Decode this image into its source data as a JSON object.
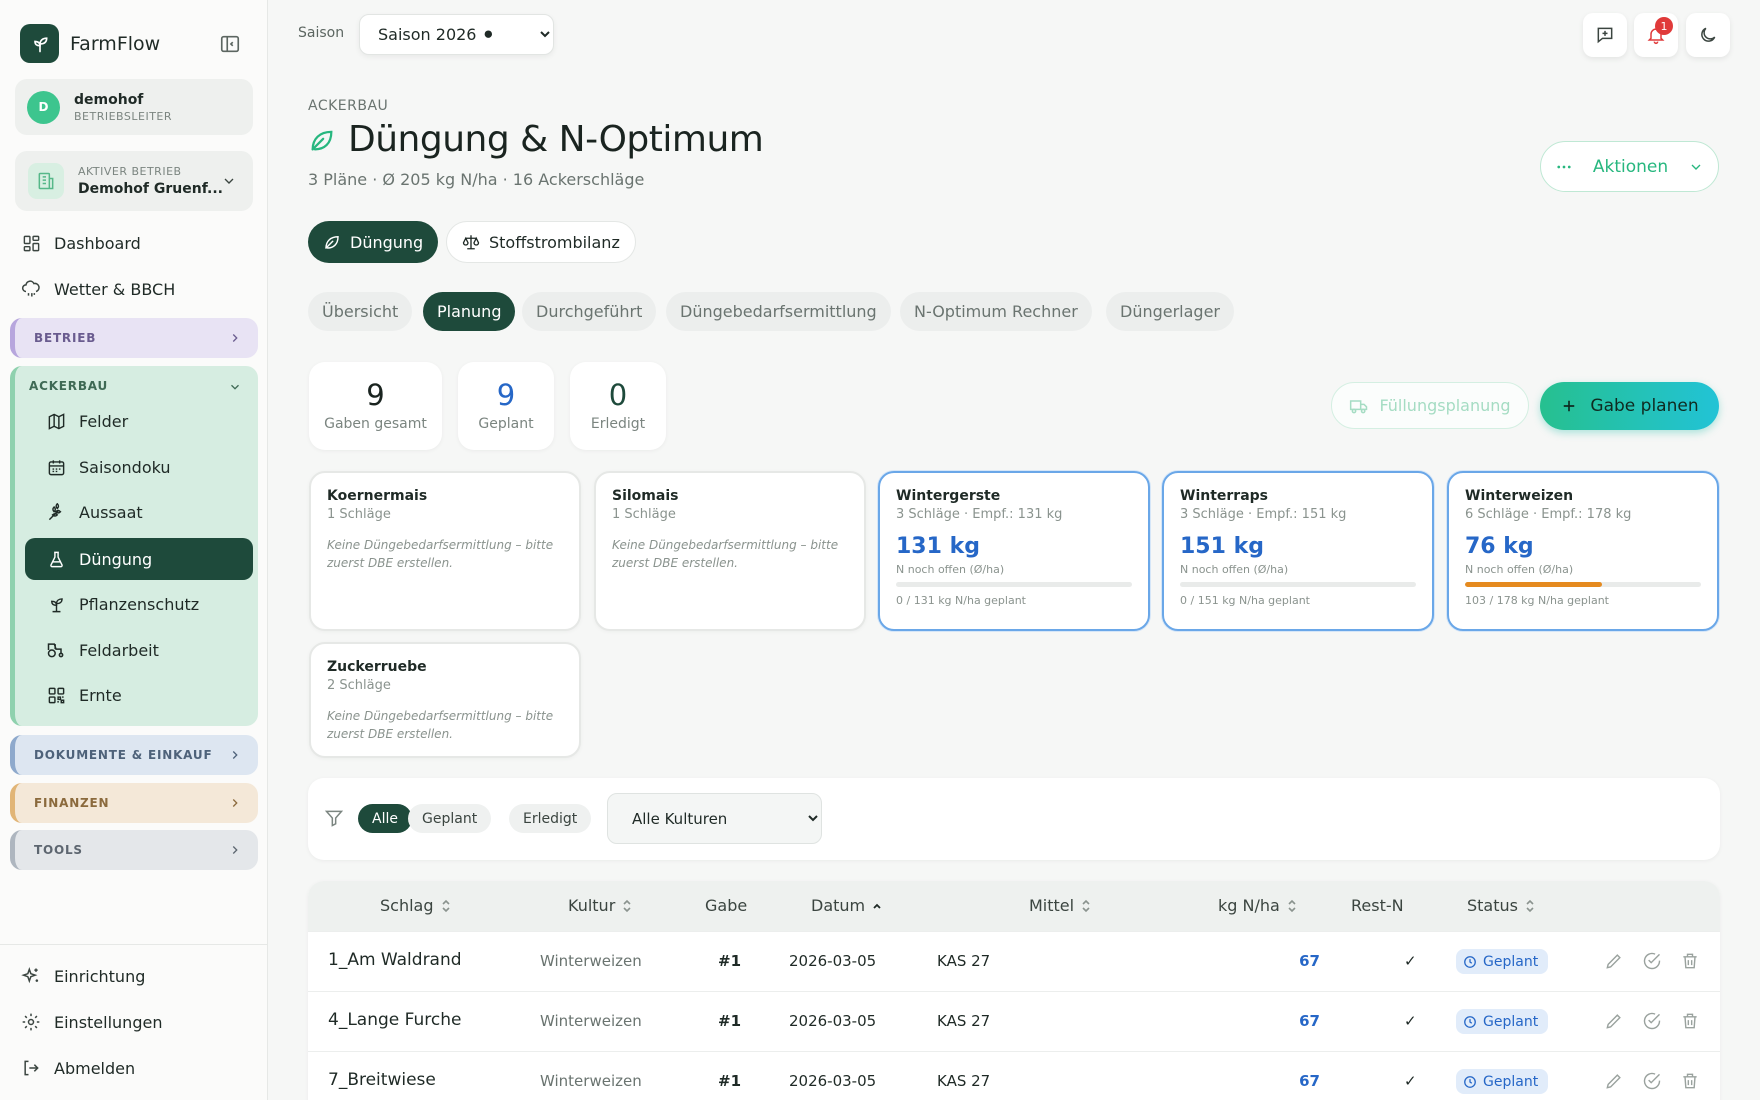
{
  "app": {
    "name": "FarmFlow"
  },
  "user": {
    "initial": "D",
    "name": "demohof",
    "role": "BETRIEBSLEITER"
  },
  "farm": {
    "label": "AKTIVER BETRIEB",
    "name": "Demohof Gruenf..."
  },
  "nav": {
    "dashboard": "Dashboard",
    "wetter": "Wetter & BBCH",
    "betrieb": "BETRIEB",
    "ackerbau": "ACKERBAU",
    "ackerbau_items": [
      "Felder",
      "Saisondoku",
      "Aussaat",
      "Düngung",
      "Pflanzenschutz",
      "Feldarbeit",
      "Ernte"
    ],
    "dokumente": "DOKUMENTE & EINKAUF",
    "finanzen": "FINANZEN",
    "tools": "TOOLS",
    "einrichtung": "Einrichtung",
    "einstellungen": "Einstellungen",
    "abmelden": "Abmelden"
  },
  "topbar": {
    "season_label": "Saison",
    "season_value": "Saison 2026 ⚫",
    "notification_count": "1"
  },
  "header": {
    "eyebrow": "ACKERBAU",
    "title": "Düngung & N-Optimum",
    "subtitle": "3 Pläne · Ø 205 kg N/ha · 16 Ackerschläge",
    "actions": "Aktionen"
  },
  "main_tabs": [
    "Düngung",
    "Stoffstrombilanz"
  ],
  "sub_tabs": [
    "Übersicht",
    "Planung",
    "Durchgeführt",
    "Düngebedarfsermittlung",
    "N-Optimum Rechner",
    "Düngerlager"
  ],
  "stats": [
    {
      "value": "9",
      "label": "Gaben gesamt",
      "color": "#1a2420"
    },
    {
      "value": "9",
      "label": "Geplant",
      "color": "#2667c7"
    },
    {
      "value": "0",
      "label": "Erledigt",
      "color": "#1e4a3b"
    }
  ],
  "buttons": {
    "fuellungsplanung": "Füllungsplanung",
    "gabe_planen": "Gabe planen"
  },
  "crops": [
    {
      "name": "Koernermais",
      "meta": "1 Schläge",
      "note": "Keine Düngebedarfsermittlung – bitte zuerst DBE erstellen."
    },
    {
      "name": "Silomais",
      "meta": "1 Schläge",
      "note": "Keine Düngebedarfsermittlung – bitte zuerst DBE erstellen."
    },
    {
      "name": "Wintergerste",
      "meta": "3 Schläge · Empf.: 131 kg",
      "kg": "131 kg",
      "open_label": "N noch offen (Ø/ha)",
      "planned": "0 / 131 kg N/ha geplant",
      "progress": 0
    },
    {
      "name": "Winterraps",
      "meta": "3 Schläge · Empf.: 151 kg",
      "kg": "151 kg",
      "open_label": "N noch offen (Ø/ha)",
      "planned": "0 / 151 kg N/ha geplant",
      "progress": 0
    },
    {
      "name": "Winterweizen",
      "meta": "6 Schläge · Empf.: 178 kg",
      "kg": "76 kg",
      "open_label": "N noch offen (Ø/ha)",
      "planned": "103 / 178 kg N/ha geplant",
      "progress": 0.58
    },
    {
      "name": "Zuckerruebe",
      "meta": "2 Schläge",
      "note": "Keine Düngebedarfsermittlung – bitte zuerst DBE erstellen."
    }
  ],
  "filters": {
    "pills": [
      "Alle",
      "Geplant",
      "Erledigt"
    ],
    "kultur": "Alle Kulturen"
  },
  "table": {
    "headers": {
      "schlag": "Schlag",
      "kultur": "Kultur",
      "gabe": "Gabe",
      "datum": "Datum",
      "mittel": "Mittel",
      "kg": "kg N/ha",
      "rest": "Rest-N",
      "status": "Status"
    },
    "rows": [
      {
        "schlag": "1_Am Waldrand",
        "kultur": "Winterweizen",
        "gabe": "#1",
        "datum": "2026-03-05",
        "mittel": "KAS 27",
        "kg": "67",
        "rest": "✓",
        "status": "Geplant"
      },
      {
        "schlag": "4_Lange Furche",
        "kultur": "Winterweizen",
        "gabe": "#1",
        "datum": "2026-03-05",
        "mittel": "KAS 27",
        "kg": "67",
        "rest": "✓",
        "status": "Geplant"
      },
      {
        "schlag": "7_Breitwiese",
        "kultur": "Winterweizen",
        "gabe": "#1",
        "datum": "2026-03-05",
        "mittel": "KAS 27",
        "kg": "67",
        "rest": "✓",
        "status": "Geplant"
      }
    ]
  },
  "colors": {
    "primary": "#1e4a3b",
    "accent": "#27b77f",
    "blue": "#2667c7",
    "warning": "#e58a1f",
    "danger": "#e03a3a"
  }
}
